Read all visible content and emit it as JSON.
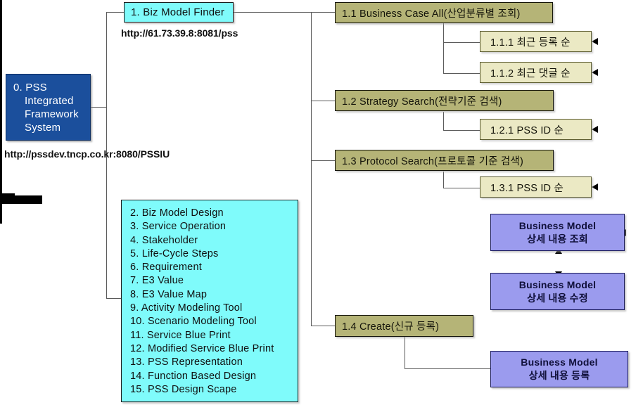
{
  "diagram": {
    "title": "PSS Integrated Framework System Sitemap",
    "colors": {
      "root_box": "#1b4f9c",
      "cyan_box": "#7ffbfb",
      "olive_box": "#b5b477",
      "beige_box": "#ebe9c4",
      "purple_box": "#9b9bee",
      "connector": "#5a5a5a",
      "arrow": "#000000",
      "background": "#ffffff"
    }
  },
  "root": {
    "line1": "0. PSS",
    "line2": "Integrated",
    "line3": "Framework",
    "line4": "System",
    "url": "http://pssdev.tncp.co.kr:8080/PSSIU"
  },
  "finder": {
    "label": "1. Biz Model Finder",
    "url": "http://61.73.39.8:8081/pss"
  },
  "modules": {
    "items": [
      "2. Biz Model Design",
      "3. Service Operation",
      "4. Stakeholder",
      "5. Life-Cycle Steps",
      "6. Requirement",
      "7. E3 Value",
      "8. E3 Value Map",
      "9. Activity Modeling Tool",
      "10. Scenario Modeling Tool",
      "11. Service Blue Print",
      "12. Modified Service Blue Print",
      "13. PSS Representation",
      "14. Function Based Design",
      "15. PSS Design Scape"
    ]
  },
  "branches": [
    {
      "label": "1.1 Business Case All(산업분류별 조회)"
    },
    {
      "label": "1.2 Strategy Search(전략기준 검색)"
    },
    {
      "label": "1.3 Protocol Search(프로토콜 기준 검색)"
    },
    {
      "label": "1.4 Create(신규 등록)"
    }
  ],
  "leaves": [
    {
      "label": "1.1.1 최근 등록 순"
    },
    {
      "label": "1.1.2 최근 댓글 순"
    },
    {
      "label": "1.2.1 PSS ID 순"
    },
    {
      "label": "1.3.1 PSS ID 순"
    }
  ],
  "detail_views": [
    {
      "line1": "Business Model",
      "line2": "상세 내용 조회"
    },
    {
      "line1": "Business Model",
      "line2": "상세 내용 수정"
    },
    {
      "line1": "Business Model",
      "line2": "상세 내용 등록"
    }
  ]
}
